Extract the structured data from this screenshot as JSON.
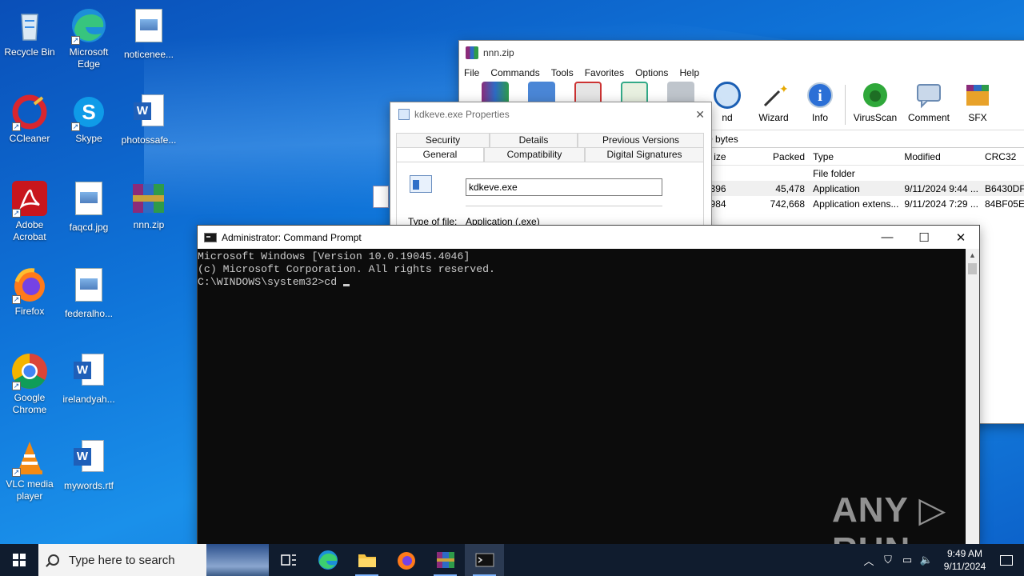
{
  "desktop": {
    "icons": [
      {
        "label": "Recycle Bin"
      },
      {
        "label": "Microsoft Edge"
      },
      {
        "label": "noticenee..."
      },
      {
        "label": "CCleaner"
      },
      {
        "label": "Skype"
      },
      {
        "label": "photossafe..."
      },
      {
        "label": "Adobe Acrobat"
      },
      {
        "label": "faqcd.jpg"
      },
      {
        "label": "nnn.zip"
      },
      {
        "label": "Firefox"
      },
      {
        "label": "federalho..."
      },
      {
        "label": "Google Chrome"
      },
      {
        "label": "irelandyah..."
      },
      {
        "label": "VLC media player"
      },
      {
        "label": "mywords.rtf"
      }
    ]
  },
  "winrar": {
    "title": "nnn.zip",
    "menu": [
      "File",
      "Commands",
      "Tools",
      "Favorites",
      "Options",
      "Help"
    ],
    "toolbar": [
      "nd",
      "Wizard",
      "Info",
      "VirusScan",
      "Comment",
      "SFX"
    ],
    "address_fragment": "0 bytes",
    "columns": {
      "size": "ize",
      "packed": "Packed",
      "type": "Type",
      "modified": "Modified",
      "crc": "CRC32"
    },
    "rows": [
      {
        "size": "",
        "packed": "",
        "type": "File folder",
        "modified": "",
        "crc": ""
      },
      {
        "size": "396",
        "packed": "45,478",
        "type": "Application",
        "modified": "9/11/2024 9:44 ...",
        "crc": "B6430DFE"
      },
      {
        "size": "984",
        "packed": "742,668",
        "type": "Application extens...",
        "modified": "9/11/2024 7:29 ...",
        "crc": "84BF05EC"
      }
    ]
  },
  "properties": {
    "title": "kdkeve.exe Properties",
    "close": "✕",
    "tabs_row1": [
      "Security",
      "Details",
      "Previous Versions"
    ],
    "tabs_row2": [
      "General",
      "Compatibility",
      "Digital Signatures"
    ],
    "filename": "kdkeve.exe",
    "type_label": "Type of file:",
    "type_value": "Application (.exe)"
  },
  "cmd": {
    "title": "Administrator: Command Prompt",
    "minimize": "—",
    "maximize": "☐",
    "close": "✕",
    "lines": [
      "Microsoft Windows [Version 10.0.19045.4046]",
      "(c) Microsoft Corporation. All rights reserved.",
      "",
      "C:\\WINDOWS\\system32>cd "
    ]
  },
  "watermark": "ANY ▷ RUN",
  "taskbar": {
    "search_placeholder": "Type here to search",
    "time": "9:49 AM",
    "date": "9/11/2024"
  },
  "colors": {
    "winrar_purple": "#8b2b7a",
    "cmd_bg": "#0c0c0c",
    "cmd_text": "#cccccc",
    "taskbar_bg": "#101c2e"
  }
}
